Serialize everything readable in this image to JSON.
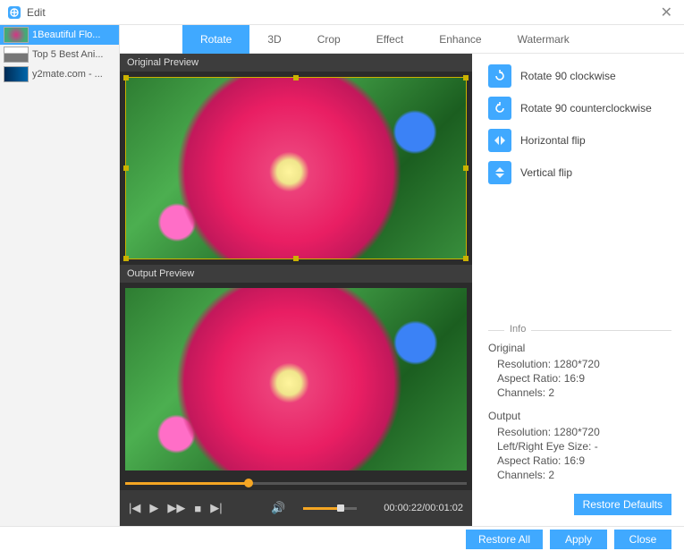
{
  "window": {
    "title": "Edit"
  },
  "sidebar": {
    "items": [
      {
        "label": "1Beautiful Flo..."
      },
      {
        "label": "Top 5 Best Ani..."
      },
      {
        "label": "y2mate.com - ..."
      }
    ]
  },
  "tabs": {
    "items": [
      {
        "label": "Rotate"
      },
      {
        "label": "3D"
      },
      {
        "label": "Crop"
      },
      {
        "label": "Effect"
      },
      {
        "label": "Enhance"
      },
      {
        "label": "Watermark"
      }
    ],
    "active_index": 0
  },
  "preview": {
    "original_label": "Original Preview",
    "output_label": "Output Preview"
  },
  "player": {
    "current": "00:00:22",
    "total": "00:01:02"
  },
  "rotate_actions": [
    {
      "label": "Rotate 90 clockwise"
    },
    {
      "label": "Rotate 90 counterclockwise"
    },
    {
      "label": "Horizontal flip"
    },
    {
      "label": "Vertical flip"
    }
  ],
  "info": {
    "header": "Info",
    "original": {
      "title": "Original",
      "resolution": "Resolution: 1280*720",
      "aspect": "Aspect Ratio: 16:9",
      "channels": "Channels: 2"
    },
    "output": {
      "title": "Output",
      "resolution": "Resolution: 1280*720",
      "eye": "Left/Right Eye Size: -",
      "aspect": "Aspect Ratio: 16:9",
      "channels": "Channels: 2"
    }
  },
  "buttons": {
    "restore_defaults": "Restore Defaults",
    "restore_all": "Restore All",
    "apply": "Apply",
    "close": "Close"
  }
}
